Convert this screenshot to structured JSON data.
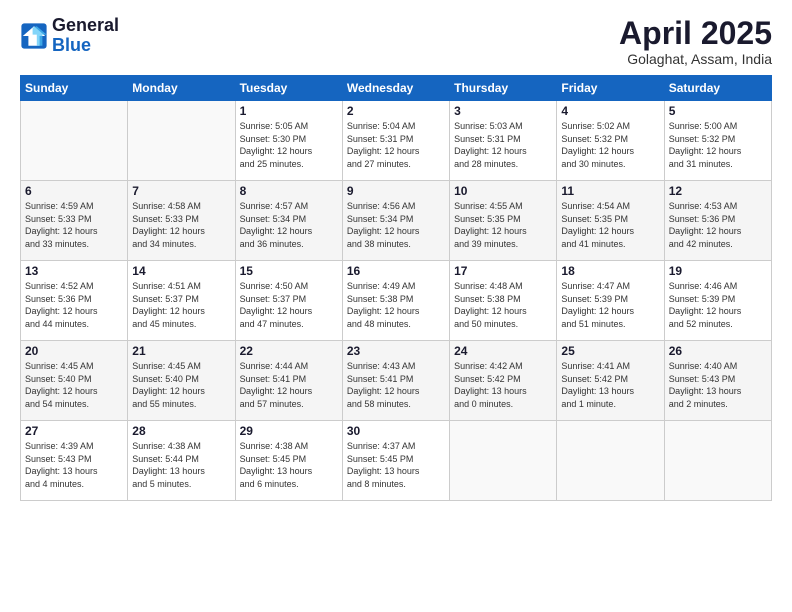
{
  "logo": {
    "general": "General",
    "blue": "Blue"
  },
  "header": {
    "title": "April 2025",
    "location": "Golaghat, Assam, India"
  },
  "columns": [
    "Sunday",
    "Monday",
    "Tuesday",
    "Wednesday",
    "Thursday",
    "Friday",
    "Saturday"
  ],
  "weeks": [
    [
      {
        "day": "",
        "info": ""
      },
      {
        "day": "",
        "info": ""
      },
      {
        "day": "1",
        "info": "Sunrise: 5:05 AM\nSunset: 5:30 PM\nDaylight: 12 hours\nand 25 minutes."
      },
      {
        "day": "2",
        "info": "Sunrise: 5:04 AM\nSunset: 5:31 PM\nDaylight: 12 hours\nand 27 minutes."
      },
      {
        "day": "3",
        "info": "Sunrise: 5:03 AM\nSunset: 5:31 PM\nDaylight: 12 hours\nand 28 minutes."
      },
      {
        "day": "4",
        "info": "Sunrise: 5:02 AM\nSunset: 5:32 PM\nDaylight: 12 hours\nand 30 minutes."
      },
      {
        "day": "5",
        "info": "Sunrise: 5:00 AM\nSunset: 5:32 PM\nDaylight: 12 hours\nand 31 minutes."
      }
    ],
    [
      {
        "day": "6",
        "info": "Sunrise: 4:59 AM\nSunset: 5:33 PM\nDaylight: 12 hours\nand 33 minutes."
      },
      {
        "day": "7",
        "info": "Sunrise: 4:58 AM\nSunset: 5:33 PM\nDaylight: 12 hours\nand 34 minutes."
      },
      {
        "day": "8",
        "info": "Sunrise: 4:57 AM\nSunset: 5:34 PM\nDaylight: 12 hours\nand 36 minutes."
      },
      {
        "day": "9",
        "info": "Sunrise: 4:56 AM\nSunset: 5:34 PM\nDaylight: 12 hours\nand 38 minutes."
      },
      {
        "day": "10",
        "info": "Sunrise: 4:55 AM\nSunset: 5:35 PM\nDaylight: 12 hours\nand 39 minutes."
      },
      {
        "day": "11",
        "info": "Sunrise: 4:54 AM\nSunset: 5:35 PM\nDaylight: 12 hours\nand 41 minutes."
      },
      {
        "day": "12",
        "info": "Sunrise: 4:53 AM\nSunset: 5:36 PM\nDaylight: 12 hours\nand 42 minutes."
      }
    ],
    [
      {
        "day": "13",
        "info": "Sunrise: 4:52 AM\nSunset: 5:36 PM\nDaylight: 12 hours\nand 44 minutes."
      },
      {
        "day": "14",
        "info": "Sunrise: 4:51 AM\nSunset: 5:37 PM\nDaylight: 12 hours\nand 45 minutes."
      },
      {
        "day": "15",
        "info": "Sunrise: 4:50 AM\nSunset: 5:37 PM\nDaylight: 12 hours\nand 47 minutes."
      },
      {
        "day": "16",
        "info": "Sunrise: 4:49 AM\nSunset: 5:38 PM\nDaylight: 12 hours\nand 48 minutes."
      },
      {
        "day": "17",
        "info": "Sunrise: 4:48 AM\nSunset: 5:38 PM\nDaylight: 12 hours\nand 50 minutes."
      },
      {
        "day": "18",
        "info": "Sunrise: 4:47 AM\nSunset: 5:39 PM\nDaylight: 12 hours\nand 51 minutes."
      },
      {
        "day": "19",
        "info": "Sunrise: 4:46 AM\nSunset: 5:39 PM\nDaylight: 12 hours\nand 52 minutes."
      }
    ],
    [
      {
        "day": "20",
        "info": "Sunrise: 4:45 AM\nSunset: 5:40 PM\nDaylight: 12 hours\nand 54 minutes."
      },
      {
        "day": "21",
        "info": "Sunrise: 4:45 AM\nSunset: 5:40 PM\nDaylight: 12 hours\nand 55 minutes."
      },
      {
        "day": "22",
        "info": "Sunrise: 4:44 AM\nSunset: 5:41 PM\nDaylight: 12 hours\nand 57 minutes."
      },
      {
        "day": "23",
        "info": "Sunrise: 4:43 AM\nSunset: 5:41 PM\nDaylight: 12 hours\nand 58 minutes."
      },
      {
        "day": "24",
        "info": "Sunrise: 4:42 AM\nSunset: 5:42 PM\nDaylight: 13 hours\nand 0 minutes."
      },
      {
        "day": "25",
        "info": "Sunrise: 4:41 AM\nSunset: 5:42 PM\nDaylight: 13 hours\nand 1 minute."
      },
      {
        "day": "26",
        "info": "Sunrise: 4:40 AM\nSunset: 5:43 PM\nDaylight: 13 hours\nand 2 minutes."
      }
    ],
    [
      {
        "day": "27",
        "info": "Sunrise: 4:39 AM\nSunset: 5:43 PM\nDaylight: 13 hours\nand 4 minutes."
      },
      {
        "day": "28",
        "info": "Sunrise: 4:38 AM\nSunset: 5:44 PM\nDaylight: 13 hours\nand 5 minutes."
      },
      {
        "day": "29",
        "info": "Sunrise: 4:38 AM\nSunset: 5:45 PM\nDaylight: 13 hours\nand 6 minutes."
      },
      {
        "day": "30",
        "info": "Sunrise: 4:37 AM\nSunset: 5:45 PM\nDaylight: 13 hours\nand 8 minutes."
      },
      {
        "day": "",
        "info": ""
      },
      {
        "day": "",
        "info": ""
      },
      {
        "day": "",
        "info": ""
      }
    ]
  ]
}
